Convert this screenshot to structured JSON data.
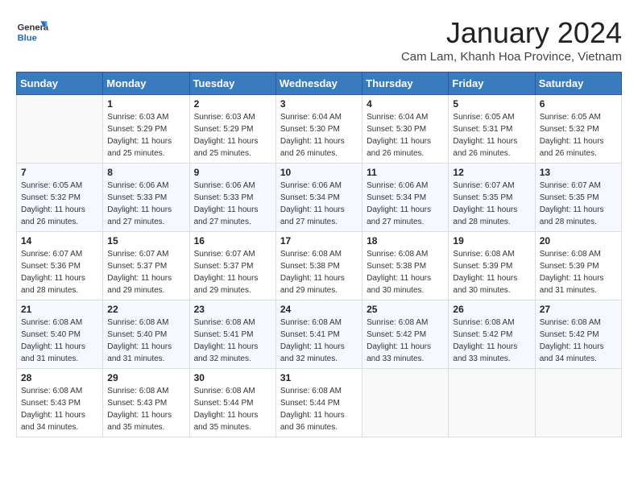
{
  "logo": {
    "general": "General",
    "blue": "Blue"
  },
  "header": {
    "title": "January 2024",
    "subtitle": "Cam Lam, Khanh Hoa Province, Vietnam"
  },
  "days_of_week": [
    "Sunday",
    "Monday",
    "Tuesday",
    "Wednesday",
    "Thursday",
    "Friday",
    "Saturday"
  ],
  "weeks": [
    [
      {
        "day": "",
        "sunrise": "",
        "sunset": "",
        "daylight": ""
      },
      {
        "day": "1",
        "sunrise": "Sunrise: 6:03 AM",
        "sunset": "Sunset: 5:29 PM",
        "daylight": "Daylight: 11 hours and 25 minutes."
      },
      {
        "day": "2",
        "sunrise": "Sunrise: 6:03 AM",
        "sunset": "Sunset: 5:29 PM",
        "daylight": "Daylight: 11 hours and 25 minutes."
      },
      {
        "day": "3",
        "sunrise": "Sunrise: 6:04 AM",
        "sunset": "Sunset: 5:30 PM",
        "daylight": "Daylight: 11 hours and 26 minutes."
      },
      {
        "day": "4",
        "sunrise": "Sunrise: 6:04 AM",
        "sunset": "Sunset: 5:30 PM",
        "daylight": "Daylight: 11 hours and 26 minutes."
      },
      {
        "day": "5",
        "sunrise": "Sunrise: 6:05 AM",
        "sunset": "Sunset: 5:31 PM",
        "daylight": "Daylight: 11 hours and 26 minutes."
      },
      {
        "day": "6",
        "sunrise": "Sunrise: 6:05 AM",
        "sunset": "Sunset: 5:32 PM",
        "daylight": "Daylight: 11 hours and 26 minutes."
      }
    ],
    [
      {
        "day": "7",
        "sunrise": "Sunrise: 6:05 AM",
        "sunset": "Sunset: 5:32 PM",
        "daylight": "Daylight: 11 hours and 26 minutes."
      },
      {
        "day": "8",
        "sunrise": "Sunrise: 6:06 AM",
        "sunset": "Sunset: 5:33 PM",
        "daylight": "Daylight: 11 hours and 27 minutes."
      },
      {
        "day": "9",
        "sunrise": "Sunrise: 6:06 AM",
        "sunset": "Sunset: 5:33 PM",
        "daylight": "Daylight: 11 hours and 27 minutes."
      },
      {
        "day": "10",
        "sunrise": "Sunrise: 6:06 AM",
        "sunset": "Sunset: 5:34 PM",
        "daylight": "Daylight: 11 hours and 27 minutes."
      },
      {
        "day": "11",
        "sunrise": "Sunrise: 6:06 AM",
        "sunset": "Sunset: 5:34 PM",
        "daylight": "Daylight: 11 hours and 27 minutes."
      },
      {
        "day": "12",
        "sunrise": "Sunrise: 6:07 AM",
        "sunset": "Sunset: 5:35 PM",
        "daylight": "Daylight: 11 hours and 28 minutes."
      },
      {
        "day": "13",
        "sunrise": "Sunrise: 6:07 AM",
        "sunset": "Sunset: 5:35 PM",
        "daylight": "Daylight: 11 hours and 28 minutes."
      }
    ],
    [
      {
        "day": "14",
        "sunrise": "Sunrise: 6:07 AM",
        "sunset": "Sunset: 5:36 PM",
        "daylight": "Daylight: 11 hours and 28 minutes."
      },
      {
        "day": "15",
        "sunrise": "Sunrise: 6:07 AM",
        "sunset": "Sunset: 5:37 PM",
        "daylight": "Daylight: 11 hours and 29 minutes."
      },
      {
        "day": "16",
        "sunrise": "Sunrise: 6:07 AM",
        "sunset": "Sunset: 5:37 PM",
        "daylight": "Daylight: 11 hours and 29 minutes."
      },
      {
        "day": "17",
        "sunrise": "Sunrise: 6:08 AM",
        "sunset": "Sunset: 5:38 PM",
        "daylight": "Daylight: 11 hours and 29 minutes."
      },
      {
        "day": "18",
        "sunrise": "Sunrise: 6:08 AM",
        "sunset": "Sunset: 5:38 PM",
        "daylight": "Daylight: 11 hours and 30 minutes."
      },
      {
        "day": "19",
        "sunrise": "Sunrise: 6:08 AM",
        "sunset": "Sunset: 5:39 PM",
        "daylight": "Daylight: 11 hours and 30 minutes."
      },
      {
        "day": "20",
        "sunrise": "Sunrise: 6:08 AM",
        "sunset": "Sunset: 5:39 PM",
        "daylight": "Daylight: 11 hours and 31 minutes."
      }
    ],
    [
      {
        "day": "21",
        "sunrise": "Sunrise: 6:08 AM",
        "sunset": "Sunset: 5:40 PM",
        "daylight": "Daylight: 11 hours and 31 minutes."
      },
      {
        "day": "22",
        "sunrise": "Sunrise: 6:08 AM",
        "sunset": "Sunset: 5:40 PM",
        "daylight": "Daylight: 11 hours and 31 minutes."
      },
      {
        "day": "23",
        "sunrise": "Sunrise: 6:08 AM",
        "sunset": "Sunset: 5:41 PM",
        "daylight": "Daylight: 11 hours and 32 minutes."
      },
      {
        "day": "24",
        "sunrise": "Sunrise: 6:08 AM",
        "sunset": "Sunset: 5:41 PM",
        "daylight": "Daylight: 11 hours and 32 minutes."
      },
      {
        "day": "25",
        "sunrise": "Sunrise: 6:08 AM",
        "sunset": "Sunset: 5:42 PM",
        "daylight": "Daylight: 11 hours and 33 minutes."
      },
      {
        "day": "26",
        "sunrise": "Sunrise: 6:08 AM",
        "sunset": "Sunset: 5:42 PM",
        "daylight": "Daylight: 11 hours and 33 minutes."
      },
      {
        "day": "27",
        "sunrise": "Sunrise: 6:08 AM",
        "sunset": "Sunset: 5:42 PM",
        "daylight": "Daylight: 11 hours and 34 minutes."
      }
    ],
    [
      {
        "day": "28",
        "sunrise": "Sunrise: 6:08 AM",
        "sunset": "Sunset: 5:43 PM",
        "daylight": "Daylight: 11 hours and 34 minutes."
      },
      {
        "day": "29",
        "sunrise": "Sunrise: 6:08 AM",
        "sunset": "Sunset: 5:43 PM",
        "daylight": "Daylight: 11 hours and 35 minutes."
      },
      {
        "day": "30",
        "sunrise": "Sunrise: 6:08 AM",
        "sunset": "Sunset: 5:44 PM",
        "daylight": "Daylight: 11 hours and 35 minutes."
      },
      {
        "day": "31",
        "sunrise": "Sunrise: 6:08 AM",
        "sunset": "Sunset: 5:44 PM",
        "daylight": "Daylight: 11 hours and 36 minutes."
      },
      {
        "day": "",
        "sunrise": "",
        "sunset": "",
        "daylight": ""
      },
      {
        "day": "",
        "sunrise": "",
        "sunset": "",
        "daylight": ""
      },
      {
        "day": "",
        "sunrise": "",
        "sunset": "",
        "daylight": ""
      }
    ]
  ]
}
